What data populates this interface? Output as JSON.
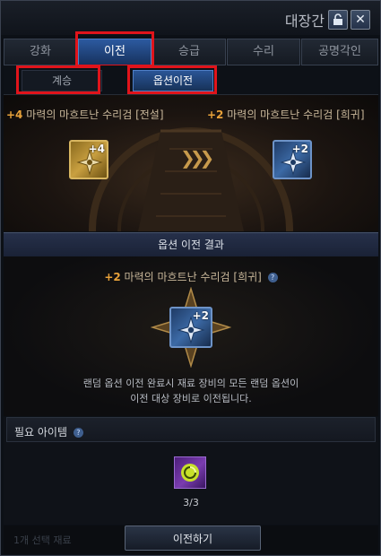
{
  "window": {
    "title": "대장간"
  },
  "tabs": [
    {
      "label": "강화"
    },
    {
      "label": "이전"
    },
    {
      "label": "승급"
    },
    {
      "label": "수리"
    },
    {
      "label": "공명각인"
    }
  ],
  "subtabs": [
    {
      "label": "계승"
    },
    {
      "label": "옵션이전"
    }
  ],
  "source_item": {
    "plus": "+4",
    "name": "마력의 마흐트난 수리검 [전설]",
    "level_badge": "+4",
    "icon": "shuriken-icon"
  },
  "target_item": {
    "plus": "+2",
    "name": "마력의 마흐트난 수리검 [희귀]",
    "level_badge": "+2",
    "icon": "shuriken-icon"
  },
  "result": {
    "header": "옵션 이전 결과",
    "plus": "+2",
    "name": "마력의 마흐트난 수리검 [희귀]",
    "level_badge": "+2",
    "help_mark": "?",
    "desc_line1": "랜덤 옵션 이전 완료시 재료 장비의 모든 랜덤 옵션이",
    "desc_line2": "이전 대상 장비로 이전됩니다."
  },
  "required": {
    "title": "필요 아이템",
    "help_mark": "?",
    "count": "3/3",
    "icon": "transfer-stone-icon"
  },
  "bottom": {
    "faint_text": "1개 선택 재료",
    "button_label": "이전하기"
  },
  "colors": {
    "accent_blue": "#2c5aa0",
    "highlight_red": "#e0141b",
    "gold": "#e8a23a",
    "purple": "#7a3cb0"
  }
}
